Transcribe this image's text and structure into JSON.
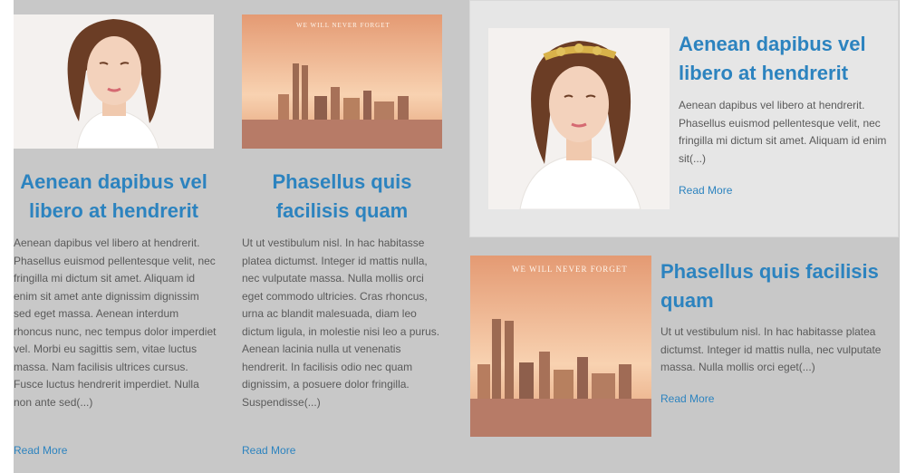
{
  "posts": [
    {
      "title": "Aenean dapibus vel libero at hendrerit",
      "excerpt": "Aenean dapibus vel libero at hendrerit. Phasellus euismod pellentesque velit, nec fringilla mi dictum sit amet. Aliquam id enim sit amet ante dignissim dignissim sed eget massa. Aenean interdum rhoncus nunc, nec tempus dolor imperdiet vel. Morbi eu sagittis sem, vitae luctus massa. Nam facilisis ultrices cursus. Fusce luctus hendrerit imperdiet. Nulla non ante sed(...)",
      "read_more": "Read More"
    },
    {
      "title": "Phasellus quis facilisis quam",
      "excerpt": "Ut ut vestibulum nisl. In hac habitasse platea dictumst. Integer id mattis nulla, nec vulputate massa. Nulla mollis orci eget commodo ultricies. Cras rhoncus, urna ac blandit malesuada, diam leo dictum ligula, in molestie nisi leo a purus. Aenean lacinia nulla ut venenatis hendrerit. In facilisis odio nec quam dignissim, a posuere dolor fringilla. Suspendisse(...)",
      "read_more": "Read More"
    },
    {
      "title": "Aenean dapibus vel libero at hendrerit",
      "excerpt": "Aenean dapibus vel libero at hendrerit. Phasellus euismod pellentesque velit, nec fringilla mi dictum sit amet. Aliquam id enim sit(...)",
      "read_more": "Read More"
    },
    {
      "title": "Phasellus quis facilisis quam",
      "excerpt": "Ut ut vestibulum nisl. In hac habitasse platea dictumst. Integer id mattis nulla, nec vulputate massa. Nulla mollis orci eget(...)",
      "read_more": "Read More"
    }
  ],
  "image_caption": "WE WILL NEVER FORGET",
  "colors": {
    "link": "#2c83bf",
    "page_background": "#c8c8c8",
    "featured_background": "#e6e6e6",
    "body_text": "#5a5a5a"
  }
}
